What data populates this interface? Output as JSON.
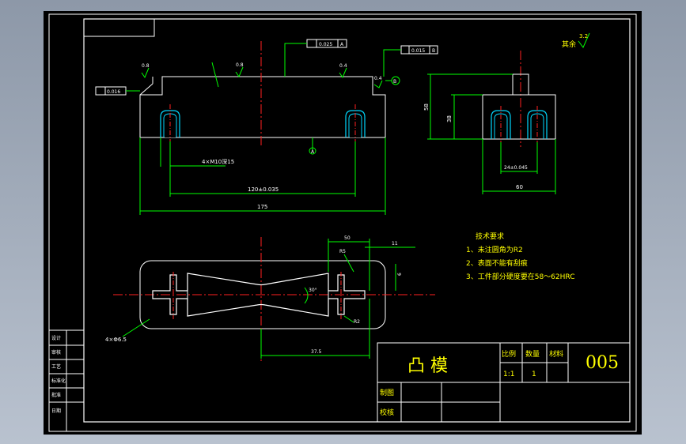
{
  "title_block": {
    "part_name": "凸 模",
    "scale_label": "比例",
    "scale_value": "1:1",
    "qty_label": "数量",
    "qty_value": "1",
    "material_label": "材料",
    "drawing_no": "005",
    "drawn_by_label": "制图",
    "checked_by_label": "校核"
  },
  "notes": {
    "heading": "技术要求",
    "items": [
      "1、未注圆角为R2",
      "2、表面不能有刮痕",
      "3、工件部分硬度要在58～62HRC"
    ]
  },
  "roughness_remaining": {
    "label": "其余",
    "value": "3.2"
  },
  "front_view": {
    "tolerance_left": "0.016",
    "datum_b": "B",
    "datum_a": "A",
    "parallel_tol": "0.025",
    "parallel_datum": "A",
    "parallel_tol_2": "0.015",
    "parallel_datum_2": "B",
    "roughness_1": "0.8",
    "roughness_2": "0.8",
    "roughness_3": "0.4",
    "roughness_4": "0.4",
    "hole_note": "4×M10深15",
    "dim_hole_spacing": "120±0.035",
    "dim_length": "175"
  },
  "side_view": {
    "dim_height": "58",
    "dim_inner": "38",
    "dim_hole_spacing": "24±0.045",
    "dim_width": "60"
  },
  "plan_view": {
    "dim_top_1": "50",
    "dim_top_2": "11",
    "dim_r": "R5",
    "dim_r2": "R2",
    "dim_side": "6",
    "dim_angle": "30°",
    "dim_bottom": "37.5",
    "hole_note": "4×Φ6.5"
  },
  "side_table": [
    "设计",
    "审核",
    "工艺",
    "标准化",
    "批准",
    "日期"
  ]
}
